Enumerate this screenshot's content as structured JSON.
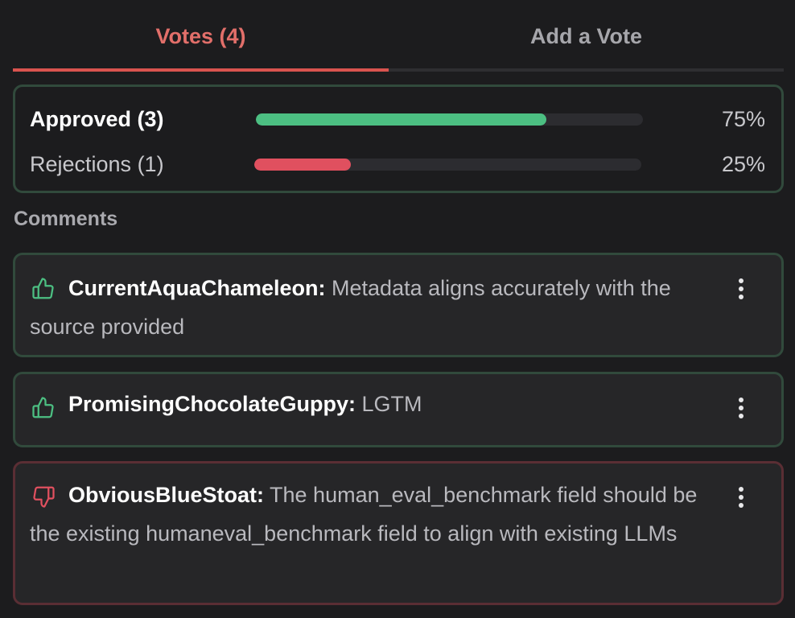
{
  "tabs": [
    {
      "label": "Votes (4)",
      "active": true
    },
    {
      "label": "Add a Vote",
      "active": false
    }
  ],
  "summary": {
    "approved": {
      "label": "Approved (3)",
      "percent_label": "75%",
      "fraction": 0.75,
      "color": "#4cbf82"
    },
    "rejected": {
      "label": "Rejections (1)",
      "percent_label": "25%",
      "fraction": 0.25,
      "color": "#e0505f"
    }
  },
  "comments_title": "Comments",
  "comments": [
    {
      "type": "approve",
      "icon": "thumbs-up-icon",
      "author": "CurrentAquaChameleon:",
      "text": " Metadata aligns accurately with the source provided"
    },
    {
      "type": "approve",
      "icon": "thumbs-up-icon",
      "author": "PromisingChocolateGuppy:",
      "text": " LGTM"
    },
    {
      "type": "reject",
      "icon": "thumbs-down-icon",
      "author": "ObviousBlueStoat:",
      "text": " The human_eval_benchmark field should be the existing humaneval_benchmark field to align with existing LLMs"
    }
  ],
  "colors": {
    "accent": "#e26f6a",
    "approve": "#4cbf82",
    "reject": "#e0505f"
  }
}
